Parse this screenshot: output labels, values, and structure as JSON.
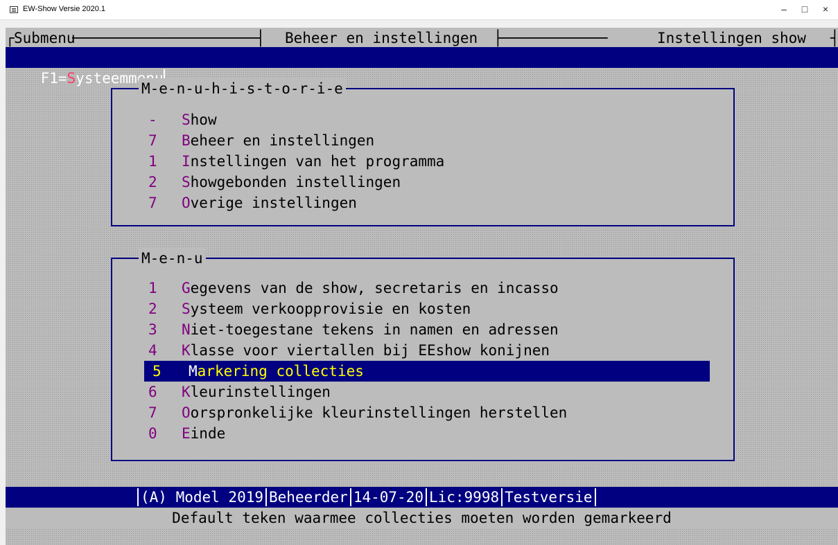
{
  "window": {
    "title": "EW-Show Versie 2020.1",
    "minimize": "–",
    "maximize": "□",
    "close": "×"
  },
  "header": {
    "left": "Submenu",
    "center": "Beheer en instellingen",
    "right": "Instellingen show"
  },
  "function_bar": {
    "prefix": "F1=",
    "hot": "S",
    "rest": "ysteemmenu"
  },
  "history": {
    "title": "M-e-n-u-h-i-s-t-o-r-i-e",
    "items": [
      {
        "key": "-",
        "hot": "S",
        "rest": "how"
      },
      {
        "key": "7",
        "hot": "B",
        "rest": "eheer en instellingen"
      },
      {
        "key": "1",
        "hot": "I",
        "rest": "nstellingen van het programma"
      },
      {
        "key": "2",
        "hot": "S",
        "rest": "howgebonden instellingen"
      },
      {
        "key": "7",
        "hot": "O",
        "rest": "verige instellingen"
      }
    ]
  },
  "menu": {
    "title": "M-e-n-u",
    "items": [
      {
        "key": "1",
        "hot": "G",
        "rest": "egevens van de show, secretaris en incasso"
      },
      {
        "key": "2",
        "hot": "S",
        "rest": "ysteem verkoopprovisie en kosten"
      },
      {
        "key": "3",
        "hot": "N",
        "rest": "iet-toegestane tekens in namen en adressen"
      },
      {
        "key": "4",
        "hot": "K",
        "rest": "lasse voor viertallen bij EEshow konijnen"
      },
      {
        "key": "5",
        "hot": "M",
        "rest": "arkering collecties"
      },
      {
        "key": "6",
        "hot": "K",
        "rest": "leurinstellingen"
      },
      {
        "key": "7",
        "hot": "O",
        "rest": "orspronkelijke kleurinstellingen herstellen"
      },
      {
        "key": "0",
        "hot": "E",
        "rest": "inde"
      }
    ],
    "selected_index": 4
  },
  "status": {
    "model": "(A) Model 2019",
    "user": "Beheerder",
    "date": "14-07-20",
    "license": "Lic:9998",
    "version": "Testversie"
  },
  "hint": "Default teken waarmee collecties moeten worden gemarkeerd",
  "colors": {
    "console_bg": "#bcbcbc",
    "bar_bg": "#000080",
    "hotkey": "#800080",
    "selected_text": "#ffff00"
  }
}
